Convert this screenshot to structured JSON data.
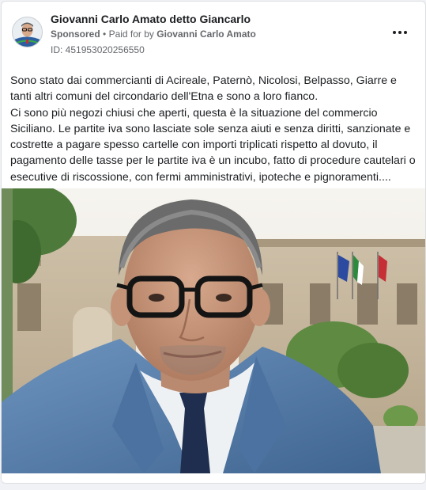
{
  "post": {
    "author_name": "Giovanni Carlo Amato detto Giancarlo",
    "sponsored_label": "Sponsored",
    "separator": "•",
    "paid_for_prefix": "Paid for by",
    "paid_for_name": "Giovanni Carlo Amato",
    "ad_id": "ID: 451953020256550",
    "paragraph_1": "Sono stato dai commercianti di Acireale, Paternò, Nicolosi, Belpasso, Giarre e tanti altri comuni del circondario dell'Etna e sono a loro fianco.",
    "paragraph_2": "Ci sono più negozi chiusi che aperti, questa è la situazione del commercio Siciliano. Le partite iva sono lasciate sole senza aiuti e senza diritti, sanzionate e costrette a pagare spesso cartelle con importi triplicati rispetto al dovuto, il pagamento delle tasse per le partite iva è un incubo, fatto di procedure cautelari o esecutive di riscossione, con fermi amministrativi, ipoteche e pignoramenti...."
  },
  "icons": {
    "more": "more-horizontal-icon",
    "avatar": "profile-avatar"
  },
  "colors": {
    "card_bg": "#ffffff",
    "page_bg": "#f0f2f5",
    "text_primary": "#1c1e21",
    "text_secondary": "#65676b",
    "jacket": "#5a7ea8",
    "flag_green": "#2e8b3e",
    "flag_red": "#c62f36",
    "eu_blue": "#2b4aa0"
  }
}
